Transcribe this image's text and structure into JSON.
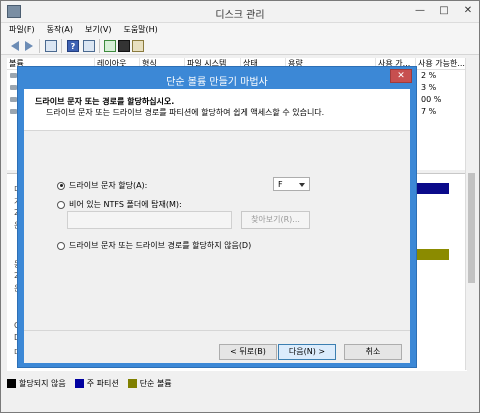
{
  "window": {
    "title": "디스크 관리",
    "controls": [
      "—",
      "□",
      "✕"
    ]
  },
  "menu": [
    "파일(F)",
    "동작(A)",
    "보기(V)",
    "도움말(H)"
  ],
  "list": {
    "columns": [
      "볼륨",
      "레이아웃",
      "형식",
      "파일 시스템",
      "상태",
      "용량",
      "사용 가...",
      "사용 가능한..."
    ],
    "percent_rows": [
      "2 %",
      "3 %",
      "00 %",
      "7 %"
    ]
  },
  "lower_pane": {
    "side_chars": [
      "디",
      "가",
      "2",
      "온",
      "동",
      "2",
      "온",
      "C",
      "D",
      "미"
    ]
  },
  "legend": [
    {
      "label": "할당되지 않음",
      "color": "#000000"
    },
    {
      "label": "주 파티션",
      "color": "#0000a0"
    },
    {
      "label": "단순 볼륨",
      "color": "#808000"
    }
  ],
  "dialog": {
    "title": "단순 볼륨 만들기 마법사",
    "close": "✕",
    "heading": "드라이브 문자 또는 경로를 할당하십시오.",
    "subheading": "드라이브 문자 또는 드라이브 경로를 파티션에 할당하여 쉽게 액세스할 수 있습니다.",
    "options": [
      {
        "label": "드라이브 문자 할당(A):",
        "selected": true
      },
      {
        "label": "비어 있는 NTFS 폴더에 탑재(M):",
        "selected": false
      },
      {
        "label": "드라이브 문자 또는 드라이브 경로를 할당하지 않음(D)",
        "selected": false
      }
    ],
    "drive_letter": "F",
    "browse_label": "찾아보기(R)...",
    "buttons": {
      "back": "< 뒤로(B)",
      "next": "다음(N) >",
      "cancel": "취소"
    }
  }
}
